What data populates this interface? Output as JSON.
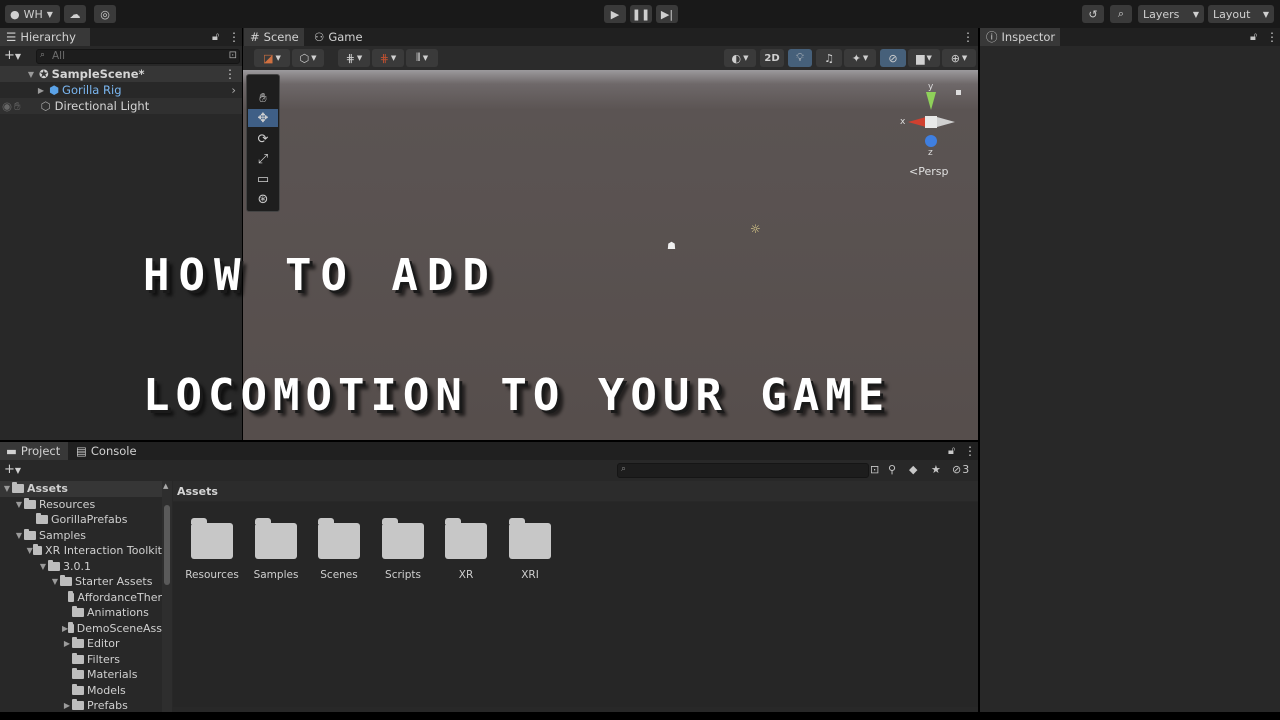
{
  "toolbar": {
    "account": "WH",
    "layers": "Layers",
    "layout": "Layout",
    "icons": {
      "play": "play-icon",
      "pause": "pause-icon",
      "step": "step-icon",
      "cloud": "cloud-icon",
      "history": "history-icon",
      "search": "search-icon"
    }
  },
  "hierarchy": {
    "tab": "Hierarchy",
    "search_placeholder": "All",
    "scene": "SampleScene*",
    "items": [
      "Gorilla Rig",
      "Directional Light"
    ]
  },
  "scene_view": {
    "tabs": [
      "Scene",
      "Game"
    ],
    "toggle_2d": "2D",
    "persp": "<Persp",
    "gizmo_axes": {
      "y": "y",
      "x": "x",
      "z": "z"
    }
  },
  "inspector": {
    "tab": "Inspector"
  },
  "overlay": {
    "line1": "HOW TO ADD",
    "line2": "LOCOMOTION TO YOUR GAME"
  },
  "project": {
    "tabs": [
      "Project",
      "Console"
    ],
    "hidden_count": "3",
    "breadcrumb": "Assets",
    "tree": [
      {
        "label": "Assets",
        "depth": 0
      },
      {
        "label": "Resources",
        "depth": 1
      },
      {
        "label": "GorillaPrefabs",
        "depth": 2
      },
      {
        "label": "Samples",
        "depth": 1
      },
      {
        "label": "XR Interaction Toolkit",
        "depth": 2
      },
      {
        "label": "3.0.1",
        "depth": 3
      },
      {
        "label": "Starter Assets",
        "depth": 4
      },
      {
        "label": "AffordanceTher",
        "depth": 5
      },
      {
        "label": "Animations",
        "depth": 5
      },
      {
        "label": "DemoSceneAss",
        "depth": 5
      },
      {
        "label": "Editor",
        "depth": 5
      },
      {
        "label": "Filters",
        "depth": 5
      },
      {
        "label": "Materials",
        "depth": 5
      },
      {
        "label": "Models",
        "depth": 5
      },
      {
        "label": "Prefabs",
        "depth": 5
      }
    ],
    "assets": [
      "Resources",
      "Samples",
      "Scenes",
      "Scripts",
      "XR",
      "XRI"
    ]
  }
}
